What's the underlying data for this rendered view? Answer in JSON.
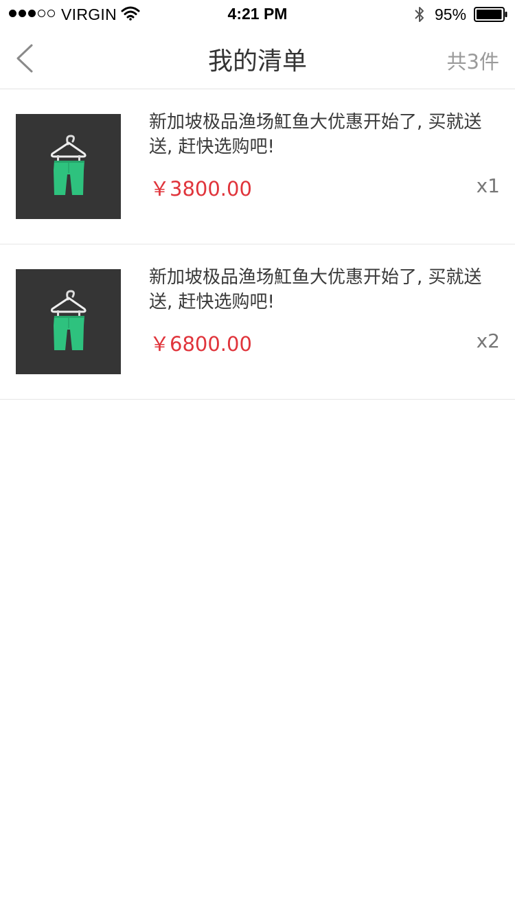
{
  "status_bar": {
    "carrier": "VIRGIN",
    "time": "4:21 PM",
    "battery": "95%",
    "battery_level": 0.95,
    "signal_bars": 3,
    "signal_total": 5
  },
  "nav": {
    "title": "我的清单",
    "count": "共3件",
    "back_icon": "chevron-left-icon"
  },
  "items": [
    {
      "title": "新加坡极品渔场魟鱼大优惠开始了, 买就送送, 赶快选购吧!",
      "price": "￥3800.00",
      "quantity": "x1",
      "image": "green-shorts-on-hanger"
    },
    {
      "title": "新加坡极品渔场魟鱼大优惠开始了, 买就送送, 赶快选购吧!",
      "price": "￥6800.00",
      "quantity": "x2",
      "image": "green-shorts-on-hanger"
    }
  ],
  "colors": {
    "price": "#e0343b",
    "thumb_bg": "#353535",
    "product": "#2ec27e",
    "muted": "#9a9a9a"
  }
}
